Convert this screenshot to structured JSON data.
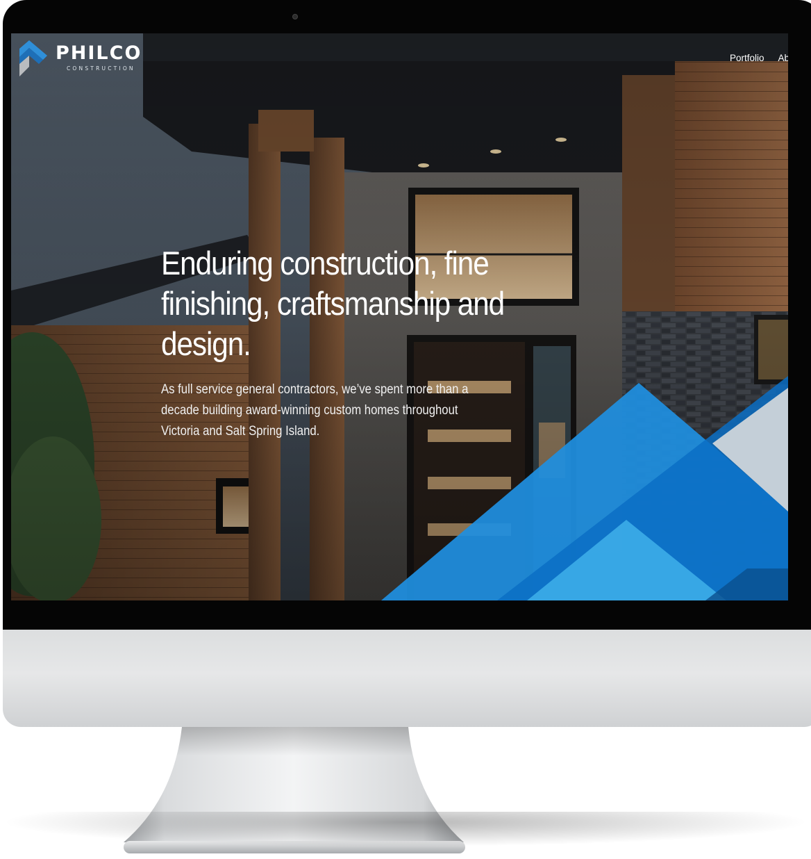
{
  "brand": {
    "name": "PHILCO",
    "tagline": "CONSTRUCTION",
    "color_blue": "#2f8fd8",
    "color_gray": "#b9bcbf"
  },
  "nav": {
    "items": [
      {
        "label": "Portfolio"
      },
      {
        "label": "Abo"
      }
    ]
  },
  "hero": {
    "headline": "Enduring construction, fine finishing, craftsmanship and design.",
    "lede": "As full service general contractors, we’ve spent more than a decade building award-winning custom homes throughout Victoria and Salt Spring Island.",
    "accent_colors": [
      "#1f8fe0",
      "#0b6fc4",
      "#3fb0ea"
    ]
  }
}
